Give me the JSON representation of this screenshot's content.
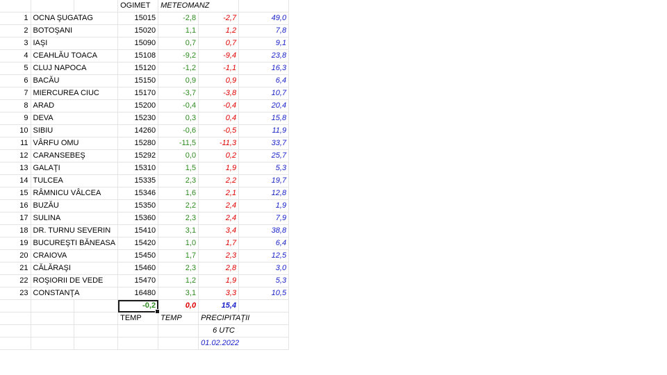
{
  "headers": {
    "ogimet": "OGIMET",
    "meteomanz": "METEOMANZ"
  },
  "rows": [
    {
      "n": "1",
      "name": "OCNA ŞUGATAG",
      "code": "15015",
      "ogimet": "-2,8",
      "meteo": "-2,7",
      "precip": "49,0"
    },
    {
      "n": "2",
      "name": "BOTOŞANI",
      "code": "15020",
      "ogimet": "1,1",
      "meteo": "1,2",
      "precip": "7,8"
    },
    {
      "n": "3",
      "name": "IAŞI",
      "code": "15090",
      "ogimet": "0,7",
      "meteo": "0,7",
      "precip": "9,1"
    },
    {
      "n": "4",
      "name": "CEAHLĂU TOACA",
      "code": "15108",
      "ogimet": "-9,2",
      "meteo": "-9,4",
      "precip": "23,8"
    },
    {
      "n": "5",
      "name": "CLUJ NAPOCA",
      "code": "15120",
      "ogimet": "-1,2",
      "meteo": "-1,1",
      "precip": "16,3"
    },
    {
      "n": "6",
      "name": "BACĂU",
      "code": "15150",
      "ogimet": "0,9",
      "meteo": "0,9",
      "precip": "6,4"
    },
    {
      "n": "7",
      "name": "MIERCUREA CIUC",
      "code": "15170",
      "ogimet": "-3,7",
      "meteo": "-3,8",
      "precip": "10,7"
    },
    {
      "n": "8",
      "name": "ARAD",
      "code": "15200",
      "ogimet": "-0,4",
      "meteo": "-0,4",
      "precip": "20,4"
    },
    {
      "n": "9",
      "name": "DEVA",
      "code": "15230",
      "ogimet": "0,3",
      "meteo": "0,4",
      "precip": "15,8"
    },
    {
      "n": "10",
      "name": "SIBIU",
      "code": "14260",
      "ogimet": "-0,6",
      "meteo": "-0,5",
      "precip": "11,9"
    },
    {
      "n": "11",
      "name": "VÂRFU OMU",
      "code": "15280",
      "ogimet": "-11,5",
      "meteo": "-11,3",
      "precip": "33,7"
    },
    {
      "n": "12",
      "name": "CARANSEBEŞ",
      "code": "15292",
      "ogimet": "0,0",
      "meteo": "0,2",
      "precip": "25,7"
    },
    {
      "n": "13",
      "name": "GALAŢI",
      "code": "15310",
      "ogimet": "1,5",
      "meteo": "1,9",
      "precip": "5,3"
    },
    {
      "n": "14",
      "name": "TULCEA",
      "code": "15335",
      "ogimet": "2,3",
      "meteo": "2,2",
      "precip": "19,7"
    },
    {
      "n": "15",
      "name": "RÂMNICU VÂLCEA",
      "code": "15346",
      "ogimet": "1,6",
      "meteo": "2,1",
      "precip": "12,8"
    },
    {
      "n": "16",
      "name": "BUZĂU",
      "code": "15350",
      "ogimet": "2,2",
      "meteo": "2,4",
      "precip": "1,9"
    },
    {
      "n": "17",
      "name": "SULINA",
      "code": "15360",
      "ogimet": "2,3",
      "meteo": "2,4",
      "precip": "7,9"
    },
    {
      "n": "18",
      "name": "DR. TURNU SEVERIN",
      "code": "15410",
      "ogimet": "3,1",
      "meteo": "3,4",
      "precip": "38,8"
    },
    {
      "n": "19",
      "name": "BUCUREŞTI BĂNEASA",
      "code": "15420",
      "ogimet": "1,0",
      "meteo": "1,7",
      "precip": "6,4"
    },
    {
      "n": "20",
      "name": "CRAIOVA",
      "code": "15450",
      "ogimet": "1,7",
      "meteo": "2,3",
      "precip": "12,5"
    },
    {
      "n": "21",
      "name": "CĂLĂRAŞI",
      "code": "15460",
      "ogimet": "2,3",
      "meteo": "2,8",
      "precip": "3,0"
    },
    {
      "n": "22",
      "name": "ROŞIORII DE VEDE",
      "code": "15470",
      "ogimet": "1,2",
      "meteo": "1,9",
      "precip": "5,3"
    },
    {
      "n": "23",
      "name": "CONSTANŢA",
      "code": "16480",
      "ogimet": "3,1",
      "meteo": "3,3",
      "precip": "10,5"
    }
  ],
  "totals": {
    "ogimet": "-0,2",
    "meteo": "0,0",
    "precip": "15,4"
  },
  "footer": {
    "temp1": "TEMP",
    "temp2": "TEMP",
    "precip": "PRECIPITAŢII",
    "time": "6 UTC",
    "date": "01.02.2022"
  },
  "colors": {
    "ogimet": "#2e8b1f",
    "meteomanz": "#e00000",
    "precip": "#1a23c8",
    "grid": "#e4e4e4"
  }
}
